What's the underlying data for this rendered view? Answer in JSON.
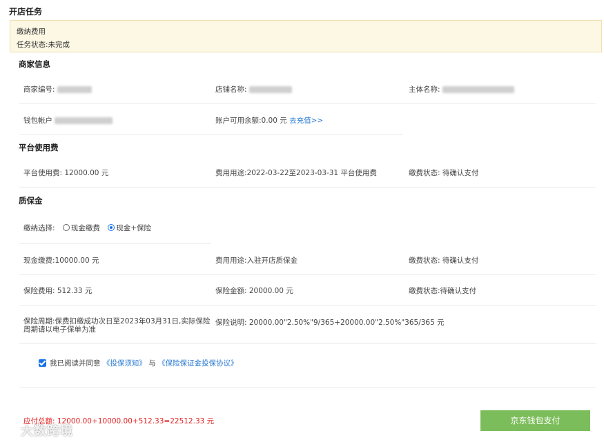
{
  "page_title": "开店任务",
  "task": {
    "name": "缴纳费用",
    "status": "任务状态:未完成"
  },
  "merchant": {
    "title": "商家信息",
    "merchant_no_label": "商家编号:",
    "shop_name_label": "店铺名称:",
    "entity_name_label": "主体名称:",
    "wallet_label": "钱包帐户",
    "balance_label": "账户可用余额:0.00 元",
    "recharge_link": "去充值>>"
  },
  "platform_fee": {
    "title": "平台使用费",
    "fee": "平台使用费: 12000.00 元",
    "usage": "费用用途:2022-03-22至2023-03-31 平台使用费",
    "status": "缴费状态: 待确认支付"
  },
  "deposit": {
    "title": "质保金",
    "choice_label": "缴纳选择:",
    "option_cash": "现金缴费",
    "option_cash_insurance": "现金+保险",
    "cash_fee": "现金缴费:10000.00 元",
    "cash_usage": "费用用途:入驻开店质保金",
    "cash_status": "缴费状态: 待确认支付",
    "insurance_fee": "保险费用: 512.33 元",
    "insurance_amount": "保险金额: 20000.00 元",
    "insurance_status": "缴费状态:待确认支付",
    "insurance_period_line1": "保险周期:保费扣缴成功次日至2023年03月31日,实际保险",
    "insurance_period_line2": "周期请以电子保单为准",
    "insurance_desc": "保险说明: 20000.00\"2.50%\"9/365+20000.00\"2.50%\"365/365 元"
  },
  "agreement": {
    "text_prefix": "我已阅读并同意",
    "link1": "《投保须知》",
    "connector": "与",
    "link2": "《保险保证金投保协议》"
  },
  "total": "应付总额: 12000.00+10000.00+512.33=22512.33 元",
  "pay_button": "京东钱包支付",
  "watermark": "大数跨境",
  "colors": {
    "accent_blue": "#1a73e8",
    "pay_green": "#7cbd5b",
    "total_red": "#e02020",
    "task_bg": "#fdf8e4"
  }
}
